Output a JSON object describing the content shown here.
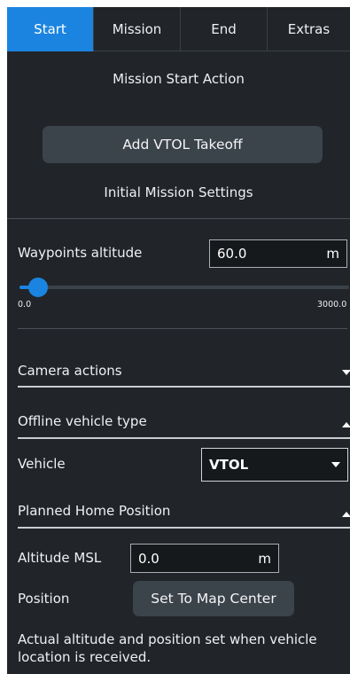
{
  "tabs": [
    {
      "label": "Start",
      "active": true
    },
    {
      "label": "Mission",
      "active": false
    },
    {
      "label": "End",
      "active": false
    },
    {
      "label": "Extras",
      "active": false
    }
  ],
  "start": {
    "section_title": "Mission Start Action",
    "add_vtol_takeoff": "Add VTOL Takeoff",
    "initial_settings_title": "Initial Mission Settings",
    "waypoints_altitude_label": "Waypoints altitude",
    "waypoints_altitude_value": "60.0",
    "waypoints_altitude_unit": "m",
    "slider": {
      "min_label": "0.0",
      "max_label": "3000.0",
      "value": 60.0,
      "min": 0.0,
      "max": 3000.0
    },
    "camera_actions_label": "Camera actions",
    "offline_vehicle_type_label": "Offline vehicle type",
    "vehicle_label": "Vehicle",
    "vehicle_value": "VTOL",
    "planned_home_label": "Planned Home Position",
    "altitude_msl_label": "Altitude MSL",
    "altitude_msl_value": "0.0",
    "altitude_msl_unit": "m",
    "position_label": "Position",
    "set_to_map_center": "Set To Map Center",
    "note": "Actual altitude and position set when vehicle location is received."
  },
  "colors": {
    "accent": "#1b84e0",
    "panel_bg": "#212529",
    "button_bg": "#3b434b",
    "field_bg": "#16191c"
  },
  "icons": {
    "camera_actions": "caret-down-icon",
    "offline_vehicle_type": "caret-up-icon",
    "vehicle_select": "caret-down-icon",
    "planned_home": "caret-up-icon"
  }
}
